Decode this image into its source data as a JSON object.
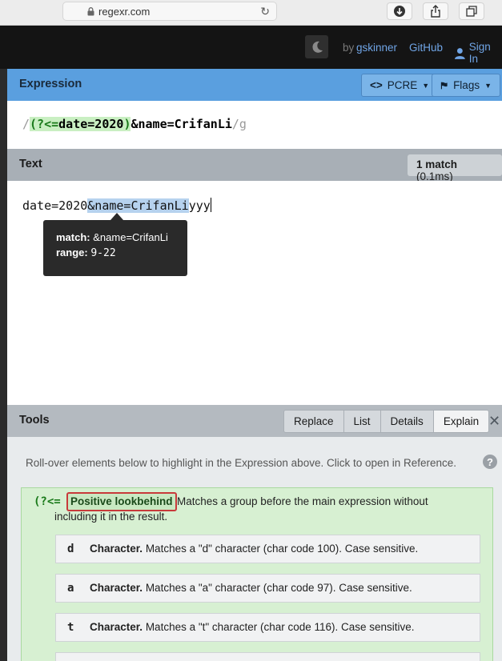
{
  "browser": {
    "url": "regexr.com"
  },
  "header": {
    "by_label": "by",
    "author": "gskinner",
    "github": "GitHub",
    "sign_in": "Sign In"
  },
  "expression": {
    "title": "Expression",
    "engine_label": "PCRE",
    "flags_label": "Flags",
    "open_slash": "/",
    "lb_open": "(?<=",
    "lb_content": "date=2020",
    "lb_close": ")",
    "rest": "&name=CrifanLi",
    "close": "/g"
  },
  "text_panel": {
    "title": "Text",
    "match_count": "1 match",
    "match_time": "(0.1ms)",
    "before": "date=2020",
    "matched": "&name=CrifanLi",
    "after": "yyy"
  },
  "tooltip": {
    "match_label": "match:",
    "match_value": "&name=CrifanLi",
    "range_label": "range:",
    "range_value": "9-22"
  },
  "tools": {
    "title": "Tools",
    "tabs": [
      "Replace",
      "List",
      "Details",
      "Explain"
    ],
    "active_tab": "Explain",
    "hint": "Roll-over elements below to highlight in the Expression above. Click to open in Reference.",
    "lookbehind": {
      "token": "(?<=",
      "name": "Positive lookbehind",
      "desc_line1": "Matches a group before the main expression without",
      "desc_line2": "including it in the result."
    },
    "chars": [
      {
        "token": "d",
        "kind": "Character.",
        "desc": "Matches a \"d\" character (char code 100). Case sensitive."
      },
      {
        "token": "a",
        "kind": "Character.",
        "desc": "Matches a \"a\" character (char code 97). Case sensitive."
      },
      {
        "token": "t",
        "kind": "Character.",
        "desc": "Matches a \"t\" character (char code 116). Case sensitive."
      }
    ]
  },
  "colors": {
    "accent": "#5a9fdf",
    "match_highlight": "#b6d2ee",
    "lookbehind_green": "#c9efc2"
  }
}
